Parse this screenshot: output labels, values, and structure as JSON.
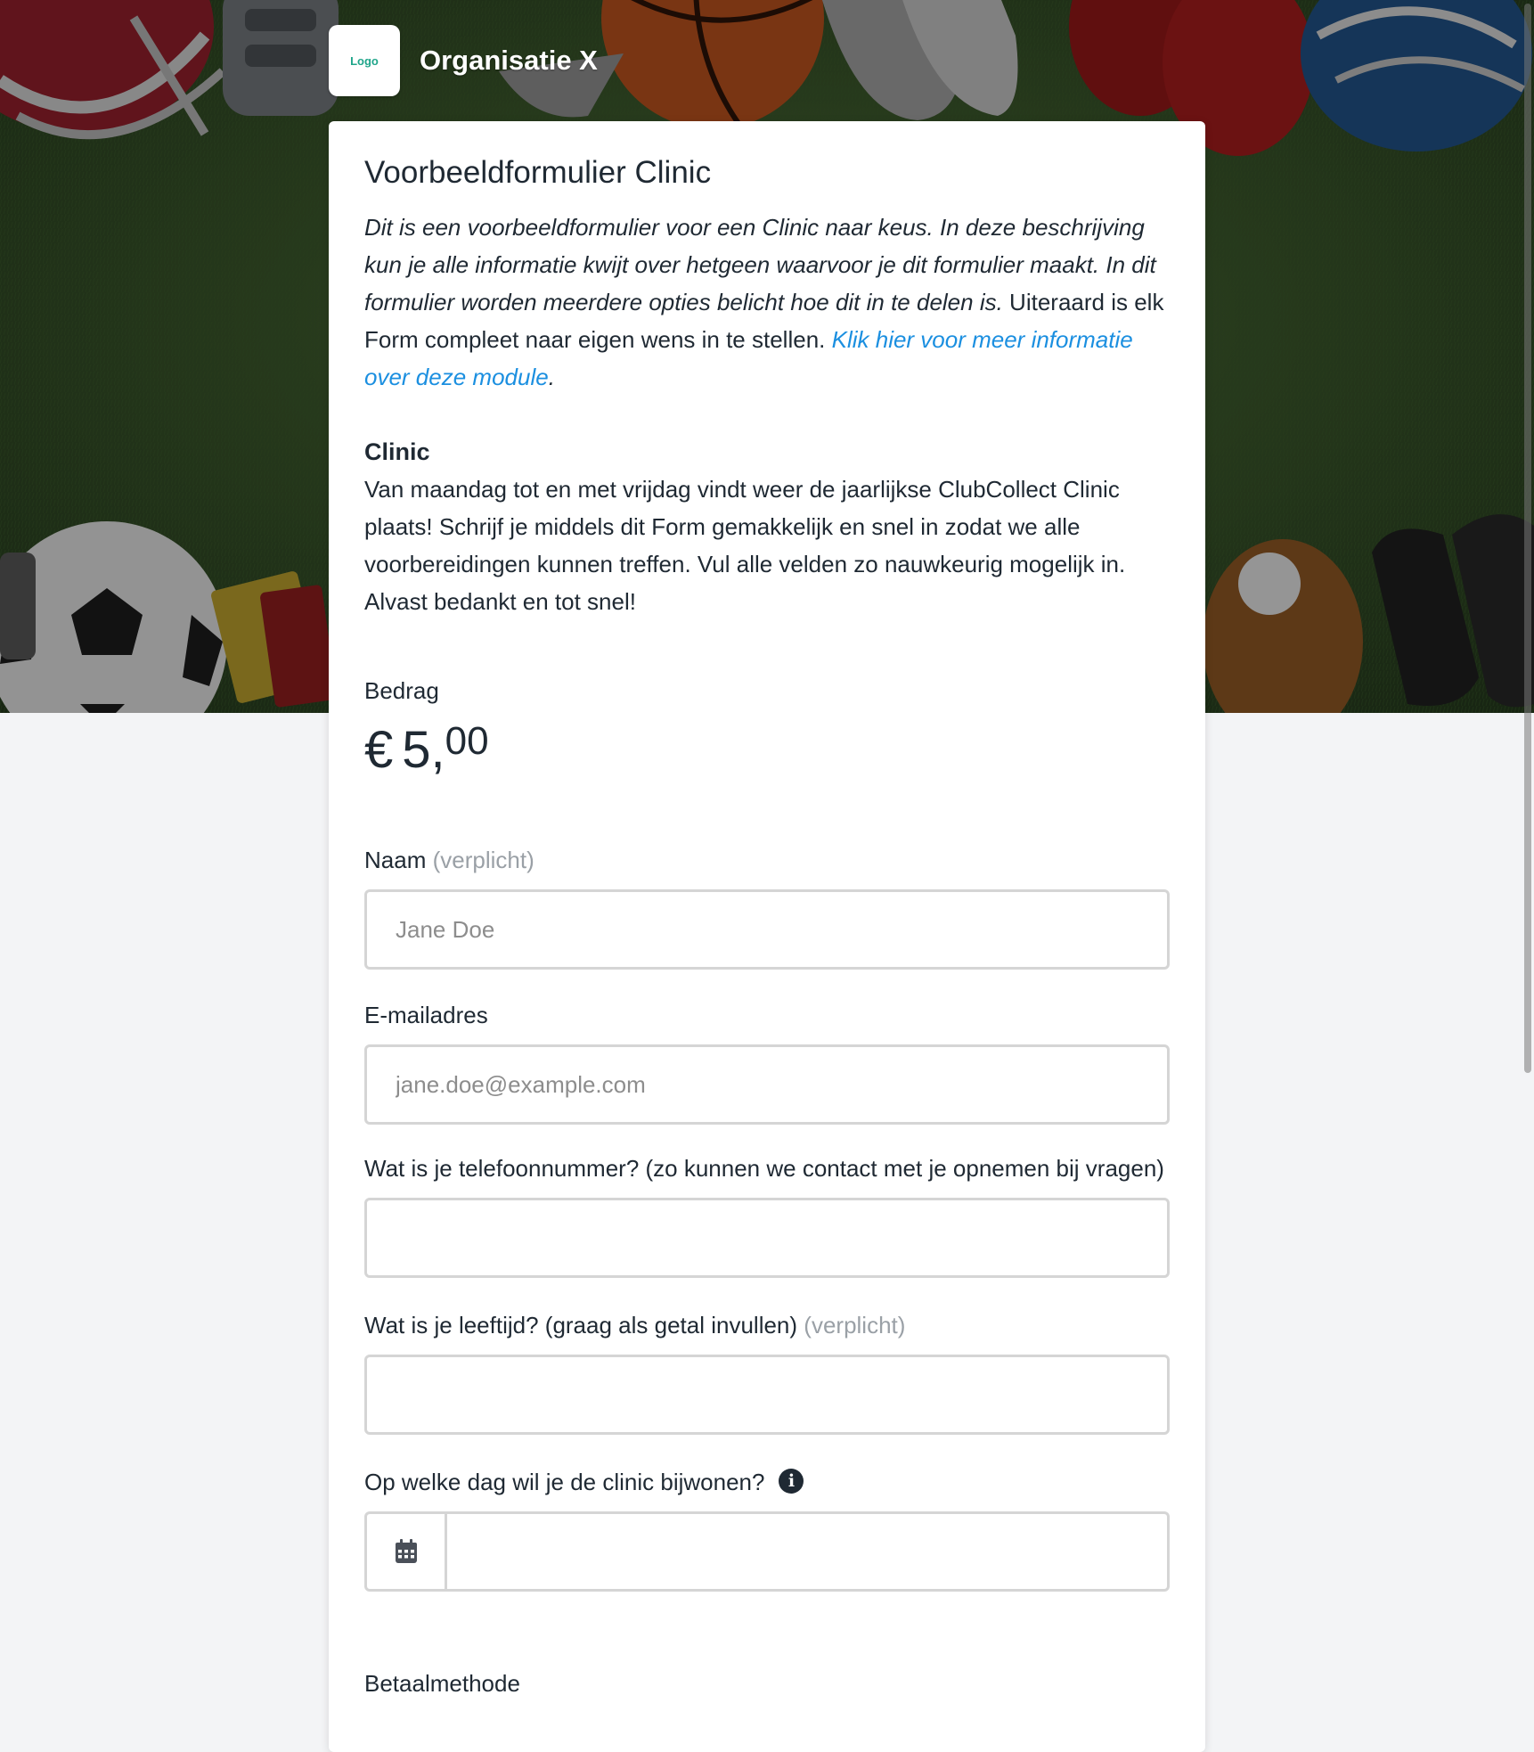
{
  "header": {
    "logo_text": "Logo",
    "org_name": "Organisatie X"
  },
  "form": {
    "title": "Voorbeeldformulier Clinic",
    "intro_italic": "Dit is een voorbeeldformulier voor een Clinic naar keus. In deze beschrijving kun je alle informatie kwijt over hetgeen waarvoor je dit formulier maakt. In dit formulier worden meerdere opties belicht hoe dit in te delen is.",
    "intro_plain": " Uiteraard is elk Form compleet naar eigen wens in te stellen. ",
    "intro_link": "Klik hier voor meer informatie over deze module",
    "intro_link_end": ".",
    "section_heading": "Clinic",
    "section_body": "Van maandag tot en met vrijdag vindt weer de jaarlijkse ClubCollect Clinic plaats! Schrijf je middels dit Form gemakkelijk en snel in zodat we alle voorbereidingen kunnen treffen. Vul alle velden zo nauwkeurig mogelijk in. Alvast bedankt en tot snel!",
    "amount_label": "Bedrag",
    "amount_currency": "€",
    "amount_whole": "5,",
    "amount_cents": "00",
    "required_text": "(verplicht)",
    "fields": {
      "name": {
        "label": "Naam",
        "placeholder": "Jane Doe",
        "value": ""
      },
      "email": {
        "label": "E-mailadres",
        "placeholder": "jane.doe@example.com",
        "value": ""
      },
      "phone": {
        "label": "Wat is je telefoonnummer? (zo kunnen we contact met je opnemen bij vragen)",
        "placeholder": "",
        "value": ""
      },
      "age": {
        "label": "Wat is je leeftijd? (graag als getal invullen)",
        "placeholder": "",
        "value": ""
      },
      "date": {
        "label": "Op welke dag wil je de clinic bijwonen?",
        "info_icon": "info-icon",
        "addon_icon": "calendar-icon",
        "value": ""
      }
    },
    "payment_heading": "Betaalmethode"
  },
  "colors": {
    "accent_link": "#1b8fe0",
    "logo_text": "#1fa58a",
    "required": "#9aa0a6",
    "input_border": "#d5d5d5",
    "page_bg": "#f3f4f6"
  }
}
